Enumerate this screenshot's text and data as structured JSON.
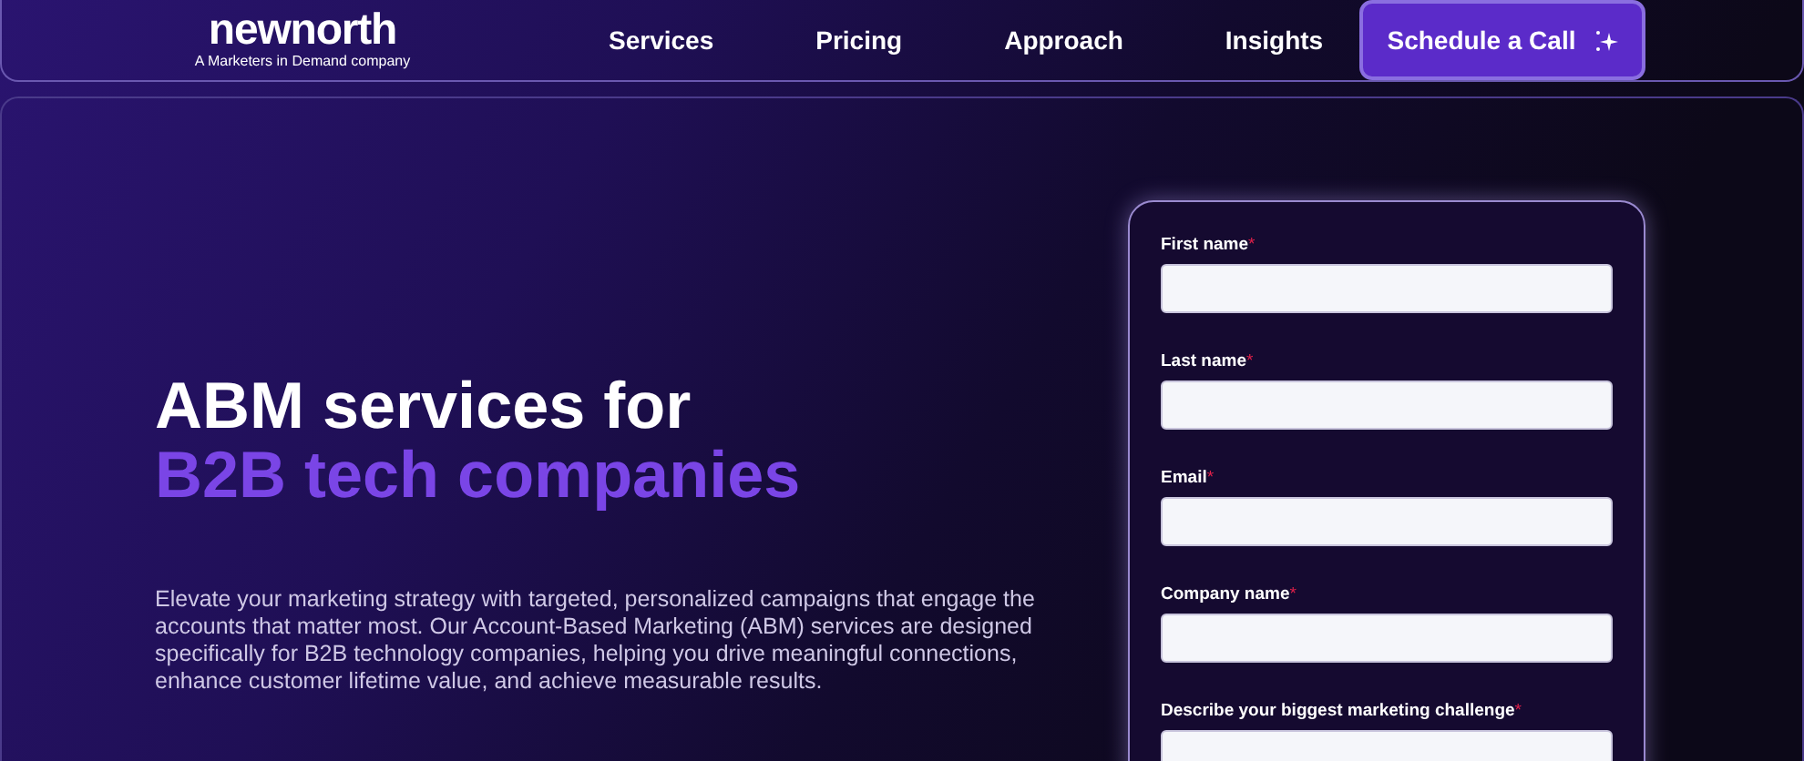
{
  "header": {
    "logo": {
      "wordmark": "newnorth",
      "tagline": "A Marketers in Demand company"
    },
    "nav": [
      "Services",
      "Pricing",
      "Approach",
      "Insights"
    ],
    "cta": {
      "label": "Schedule a Call"
    }
  },
  "hero": {
    "title_line1": "ABM services for",
    "title_line2": "B2B tech companies",
    "description": "Elevate your marketing strategy with targeted, personalized campaigns that engage the accounts that matter most. Our Account-Based Marketing (ABM) services are designed specifically for B2B technology companies, helping you drive meaningful connections, enhance customer lifetime value, and achieve measurable results."
  },
  "form": {
    "fields": [
      {
        "label": "First name",
        "mark": "*"
      },
      {
        "label": "Last name",
        "mark": "*"
      },
      {
        "label": "Email",
        "mark": "*"
      },
      {
        "label": "Company name",
        "mark": "*"
      },
      {
        "label": "Describe your biggest marketing challenge",
        "mark": "*"
      }
    ]
  }
}
